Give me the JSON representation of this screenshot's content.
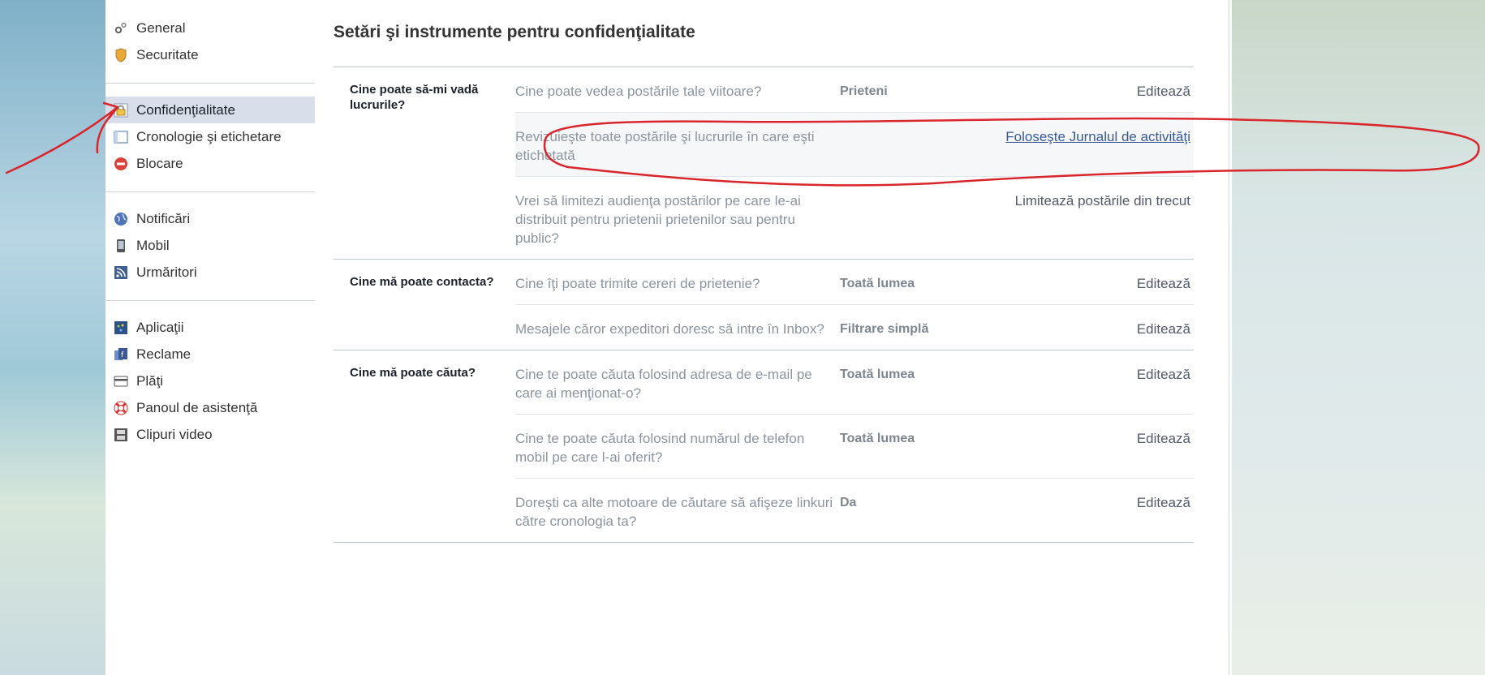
{
  "sidebar": {
    "groups": [
      [
        {
          "label": "General",
          "icon": "gears-icon"
        },
        {
          "label": "Securitate",
          "icon": "shield-icon"
        }
      ],
      [
        {
          "label": "Confidenţialitate",
          "icon": "lock-icon",
          "active": true
        },
        {
          "label": "Cronologie şi etichetare",
          "icon": "timeline-icon"
        },
        {
          "label": "Blocare",
          "icon": "block-icon"
        }
      ],
      [
        {
          "label": "Notificări",
          "icon": "globe-icon"
        },
        {
          "label": "Mobil",
          "icon": "mobile-icon"
        },
        {
          "label": "Urmăritori",
          "icon": "rss-icon"
        }
      ],
      [
        {
          "label": "Aplicaţii",
          "icon": "apps-icon"
        },
        {
          "label": "Reclame",
          "icon": "ads-icon"
        },
        {
          "label": "Plăţi",
          "icon": "card-icon"
        },
        {
          "label": "Panoul de asistenţă",
          "icon": "lifebuoy-icon"
        },
        {
          "label": "Clipuri video",
          "icon": "film-icon"
        }
      ]
    ]
  },
  "main": {
    "title": "Setări şi instrumente pentru confidenţialitate",
    "sections": [
      {
        "label": "Cine poate să-mi vadă lucrurile?",
        "rows": [
          {
            "question": "Cine poate vedea postările tale viitoare?",
            "value": "Prieteni",
            "action": "Editează"
          },
          {
            "question": "Revizuieşte toate postările şi lucrurile în care eşti etichetată",
            "value": "",
            "action": "Foloseşte Jurnalul de activităţi",
            "link": true,
            "shaded": true
          },
          {
            "question": "Vrei să limitezi audienţa postărilor pe care le-ai distribuit pentru prietenii prietenilor sau pentru public?",
            "value": "",
            "action": "Limitează postările din trecut"
          }
        ]
      },
      {
        "label": "Cine mă poate contacta?",
        "rows": [
          {
            "question": "Cine îţi poate trimite cereri de prietenie?",
            "value": "Toată lumea",
            "action": "Editează"
          },
          {
            "question": "Mesajele căror expeditori doresc să intre în Inbox?",
            "value": "Filtrare simplă",
            "action": "Editează"
          }
        ]
      },
      {
        "label": "Cine mă poate căuta?",
        "rows": [
          {
            "question": "Cine te poate căuta folosind adresa de e-mail pe care ai menţionat-o?",
            "value": "Toată lumea",
            "action": "Editează"
          },
          {
            "question": "Cine te poate căuta folosind numărul de telefon mobil pe care l-ai oferit?",
            "value": "Toată lumea",
            "action": "Editează"
          },
          {
            "question": "Doreşti ca alte motoare de căutare să afişeze linkuri către cronologia ta?",
            "value": "Da",
            "action": "Editează"
          }
        ]
      }
    ]
  },
  "annotations": {
    "color": "#d9262c"
  }
}
